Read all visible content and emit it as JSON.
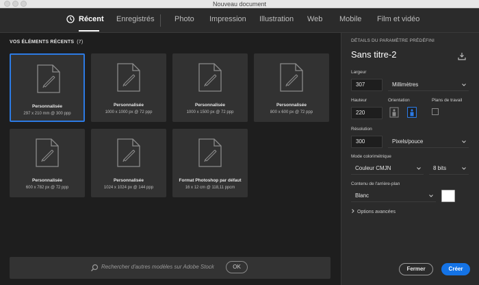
{
  "window": {
    "title": "Nouveau document"
  },
  "tabs": [
    {
      "label": "Récent",
      "active": true
    },
    {
      "label": "Enregistrés",
      "active": false
    },
    {
      "label": "Photo",
      "active": false
    },
    {
      "label": "Impression",
      "active": false
    },
    {
      "label": "Illustration",
      "active": false
    },
    {
      "label": "Web",
      "active": false
    },
    {
      "label": "Mobile",
      "active": false
    },
    {
      "label": "Film et vidéo",
      "active": false
    }
  ],
  "recent": {
    "title": "VOS ÉLÉMENTS RÉCENTS",
    "count": "(7)",
    "items": [
      {
        "name": "Personnalisée",
        "size": "297 x 210 mm @ 300 ppp",
        "selected": true
      },
      {
        "name": "Personnalisée",
        "size": "1000 x 1000 px @ 72 ppp",
        "selected": false
      },
      {
        "name": "Personnalisée",
        "size": "1000 x 1500 px @ 72 ppp",
        "selected": false
      },
      {
        "name": "Personnalisée",
        "size": "800 x 600 px @ 72 ppp",
        "selected": false
      },
      {
        "name": "Personnalisée",
        "size": "600 x 782 px @ 72 ppp",
        "selected": false
      },
      {
        "name": "Personnalisée",
        "size": "1024 x 1024 px @ 144 ppp",
        "selected": false
      },
      {
        "name": "Format Photoshop par défaut",
        "size": "16 x 12 cm @ 118,11 ppcm",
        "selected": false
      }
    ]
  },
  "search": {
    "placeholder": "Rechercher d'autres modèles sur Adobe Stock",
    "ok_label": "OK"
  },
  "preset": {
    "heading": "DÉTAILS DU PARAMÈTRE PRÉDÉFINI",
    "doc_name": "Sans titre-2",
    "width_label": "Largeur",
    "width_value": "307",
    "width_unit": "Millimètres",
    "height_label": "Hauteur",
    "height_value": "220",
    "orientation_label": "Orientation",
    "artboards_label": "Plans de travail",
    "resolution_label": "Résolution",
    "resolution_value": "300",
    "resolution_unit": "Pixels/pouce",
    "color_mode_label": "Mode colorimétrique",
    "color_mode_value": "Couleur CMJN",
    "bit_depth_value": "8 bits",
    "background_label": "Contenu de l'arrière-plan",
    "background_value": "Blanc",
    "background_color": "#ffffff",
    "advanced_label": "Options avancées"
  },
  "actions": {
    "close_label": "Fermer",
    "create_label": "Créer"
  },
  "colors": {
    "accent": "#1473e6",
    "selected_border": "#2c7be5"
  }
}
